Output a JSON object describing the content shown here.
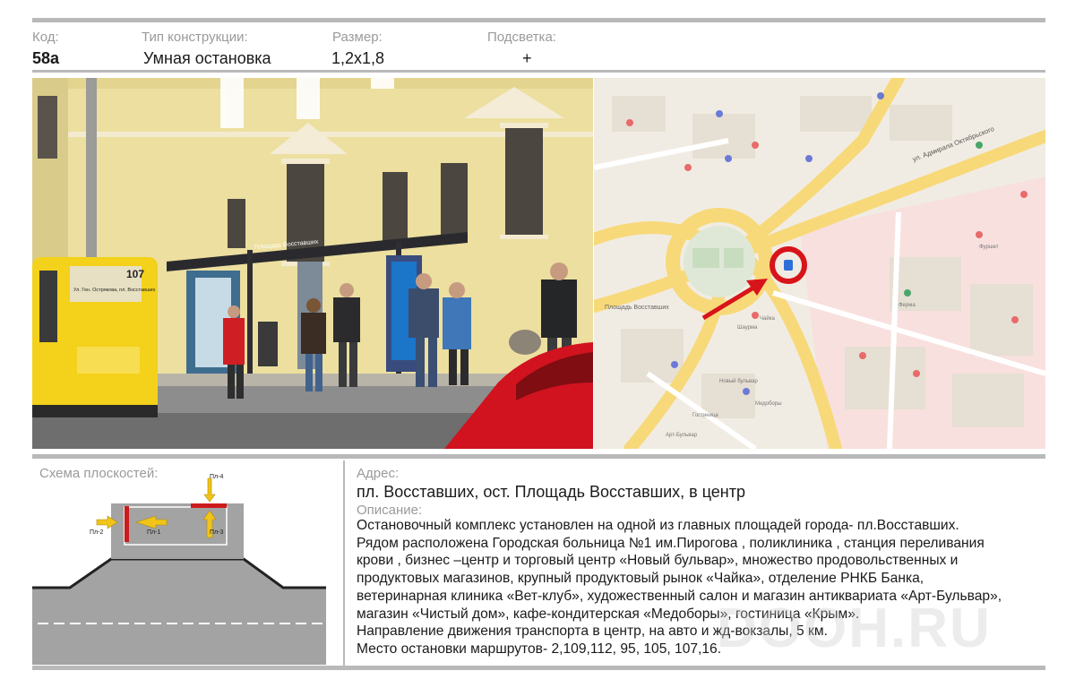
{
  "header": {
    "code_label": "Код:",
    "code_value": "58а",
    "type_label": "Тип конструкции:",
    "type_value": "Умная остановка",
    "size_label": "Размер:",
    "size_value": "1,2х1,8",
    "light_label": "Подсветка:",
    "light_value": "+"
  },
  "photo": {
    "shelter_sign": "Площадь Восставших",
    "bus_number": "107",
    "bus_route": "Ул. Ген. Острякова, пл. Восставших"
  },
  "map": {
    "street_label": "ул. Адмирала Октябрьского",
    "square_label": "Площадь Восставших",
    "poi_labels": [
      "Гостиница",
      "Новый бульвар",
      "Чайка",
      "Шаурма",
      "Арт-Бульвар",
      "Фуршет",
      "Медоборы",
      "Ферма"
    ]
  },
  "scheme": {
    "title": "Схема плоскостей:",
    "labels": {
      "p1": "Пл-1",
      "p2": "Пл-2",
      "p3": "Пл-3",
      "p4": "Пл-4"
    }
  },
  "address": {
    "label": "Адрес:",
    "value": "пл. Восставших, ост. Площадь Восставших, в центр"
  },
  "description": {
    "label": "Описание:",
    "lines": [
      "Остановочный  комплекс установлен на одной из главных площадей города- пл.Восставших.",
      "Рядом расположена  Городская больница №1 им.Пирогова , поликлиника , станция переливания",
      "крови , бизнес –центр и торговый центр «Новый бульвар», множество продовольственных и",
      "продуктовых магазинов, крупный продуктовый рынок «Чайка», отделение РНКБ Банка,",
      "ветеринарная клиника «Вет-клуб»,  художественный салон и магазин антиквариата «Арт-Бульвар»,",
      "магазин «Чистый дом», кафе-кондитерская «Медоборы», гостиница «Крым».",
      "Направление движения транспорта в центр, на авто и жд-вокзалы, 5 км.",
      "Место остановки маршрутов- 2,109,112, 95, 105, 107,16."
    ]
  },
  "watermark": "DOOH.RU"
}
